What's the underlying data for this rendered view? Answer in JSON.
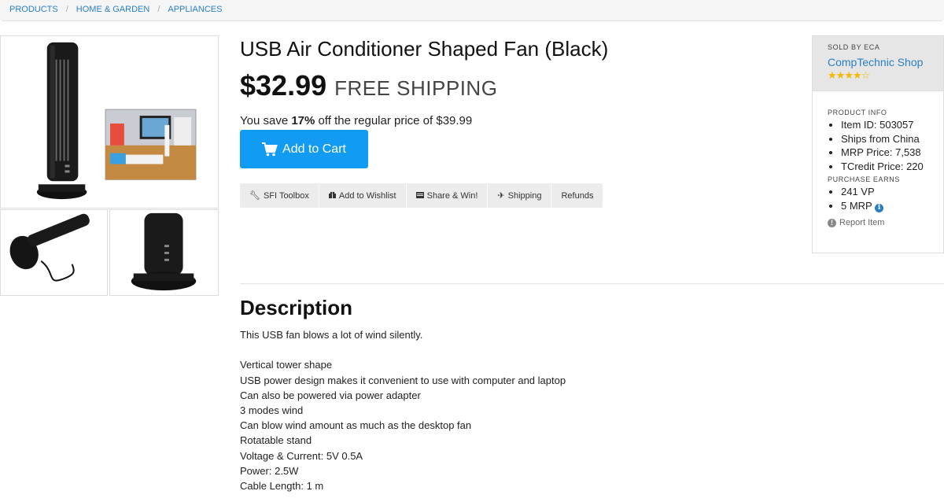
{
  "breadcrumb": [
    "PRODUCTS",
    "HOME & GARDEN",
    "APPLIANCES"
  ],
  "product": {
    "title": "USB Air Conditioner Shaped Fan (Black)",
    "price": "$32.99",
    "shipping": "FREE SHIPPING",
    "save_prefix": "You save ",
    "save_percent": "17%",
    "save_suffix": " off the regular price of $39.99",
    "cart_label": "Add to Cart"
  },
  "actions": [
    {
      "label": "SFI Toolbox",
      "icon": "wrench-icon"
    },
    {
      "label": "Add to Wishlist",
      "icon": "gift-icon"
    },
    {
      "label": "Share & Win!",
      "icon": "share-icon"
    },
    {
      "label": "Shipping",
      "icon": "plane-icon"
    },
    {
      "label": "Refunds",
      "icon": ""
    }
  ],
  "seller": {
    "sold_by": "SOLD BY ECA",
    "shop": "CompTechnic Shop",
    "rating": 4,
    "rating_max": 5,
    "star_color": "#f5b800"
  },
  "product_info": {
    "label": "PRODUCT INFO",
    "items": [
      "Item ID: 503057",
      "Ships from China",
      "MRP Price: 7,538",
      "TCredit Price: 220"
    ]
  },
  "purchase_earns": {
    "label": "PURCHASE EARNS",
    "items": [
      "241 VP",
      "5 MRP"
    ]
  },
  "report_label": "Report Item",
  "description": {
    "title": "Description",
    "intro": "This USB fan blows a lot of wind silently.",
    "lines": [
      "Vertical tower shape",
      "USB power design makes it convenient to use with computer and laptop",
      "Can also be powered via power adapter",
      "3 modes wind",
      "Can blow wind amount as much as the desktop fan",
      "Rotatable stand",
      "Voltage & Current: 5V 0.5A",
      "Power: 2.5W",
      "Cable Length: 1 m"
    ]
  },
  "colors": {
    "accent": "#119bf2",
    "link": "#2a7fc4"
  }
}
